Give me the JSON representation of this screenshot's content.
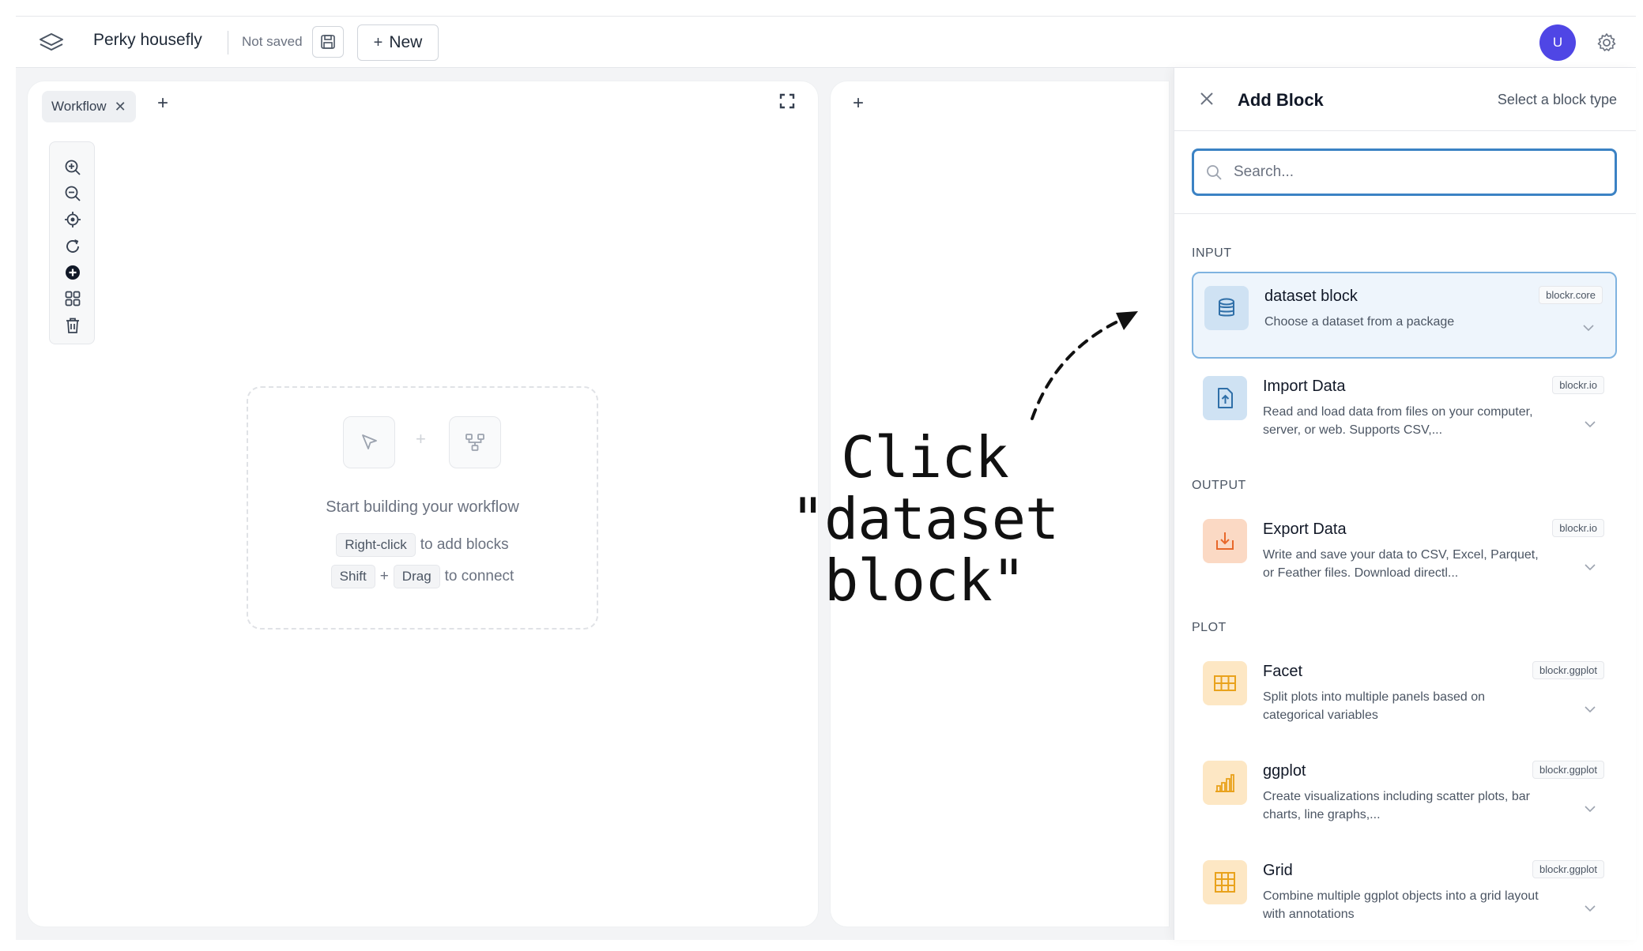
{
  "header": {
    "app_title": "Perky housefly",
    "save_status": "Not saved",
    "new_label": "New",
    "avatar_initial": "U"
  },
  "workflow_panel": {
    "tab_label": "Workflow",
    "empty_state": {
      "title": "Start building your workflow",
      "hint1_key": "Right-click",
      "hint1_text": "to add blocks",
      "hint2_key1": "Shift",
      "hint2_plus": "+",
      "hint2_key2": "Drag",
      "hint2_text": "to connect"
    },
    "toolbar_tools": [
      "zoom-in-icon",
      "zoom-out-icon",
      "center-icon",
      "refresh-icon",
      "add-icon",
      "layout-icon",
      "trash-icon"
    ]
  },
  "annotation": {
    "line1": "Click \"dataset",
    "line2": "block\""
  },
  "side_panel": {
    "title": "Add Block",
    "subtitle": "Select a block type",
    "search_placeholder": "Search...",
    "sections": {
      "input": "INPUT",
      "output": "OUTPUT",
      "plot": "PLOT"
    },
    "blocks": [
      {
        "title": "dataset block",
        "desc": "Choose a dataset from a package",
        "badge": "blockr.core",
        "icon": "database-icon",
        "selected": true
      },
      {
        "title": "Import Data",
        "desc": "Read and load data from files on your computer, server, or web. Supports CSV,...",
        "badge": "blockr.io",
        "icon": "file-upload-icon"
      },
      {
        "title": "Export Data",
        "desc": "Write and save your data to CSV, Excel, Parquet, or Feather files. Download directl...",
        "badge": "blockr.io",
        "icon": "download-icon"
      },
      {
        "title": "Facet",
        "desc": "Split plots into multiple panels based on categorical variables",
        "badge": "blockr.ggplot",
        "icon": "table-icon"
      },
      {
        "title": "ggplot",
        "desc": "Create visualizations including scatter plots, bar charts, line graphs,...",
        "badge": "blockr.ggplot",
        "icon": "bar-chart-icon"
      },
      {
        "title": "Grid",
        "desc": "Combine multiple ggplot objects into a grid layout with annotations",
        "badge": "blockr.ggplot",
        "icon": "grid-icon"
      }
    ]
  },
  "colors": {
    "accent": "#3b82c4",
    "avatar": "#4f46e5",
    "input_icon_bg": "#cfe2f3",
    "input_icon_fg": "#2f6fa8",
    "output_icon_bg": "#fbd9c4",
    "output_icon_fg": "#e8682a",
    "plot_icon_bg": "#fde7c4",
    "plot_icon_fg": "#e9a21c"
  }
}
